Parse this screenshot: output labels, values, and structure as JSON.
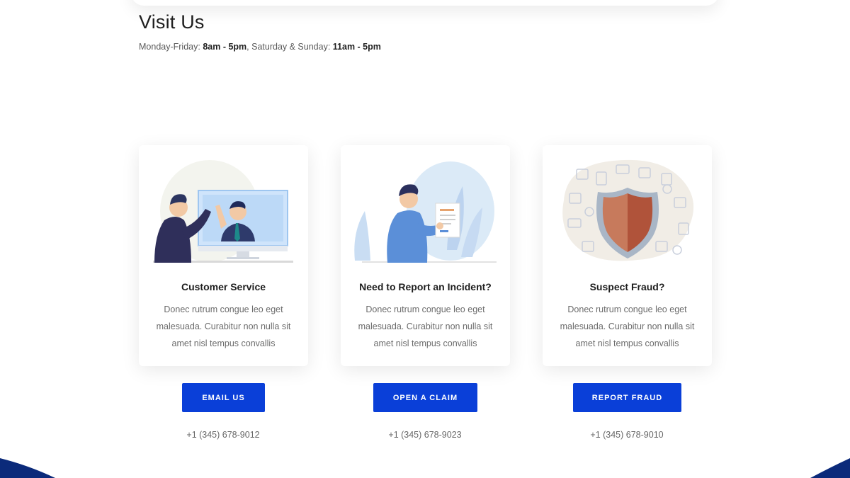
{
  "header": {
    "title": "Visit Us",
    "hours": {
      "weekday_label": "Monday-Friday:",
      "weekday_hours": "8am - 5pm",
      "weekend_label": ", Saturday & Sunday:",
      "weekend_hours": "11am - 5pm"
    }
  },
  "cards": [
    {
      "title": "Customer Service",
      "body": "Donec rutrum congue leo eget malesuada. Curabitur non nulla sit amet nisl tempus convallis",
      "button": "EMAIL US",
      "phone": "+1 (345) 678-9012",
      "icon": "customer-service-illustration"
    },
    {
      "title": "Need to Report an Incident?",
      "body": "Donec rutrum congue leo eget malesuada. Curabitur non nulla sit amet nisl tempus convallis",
      "button": "OPEN A CLAIM",
      "phone": "+1 (345) 678-9023",
      "icon": "report-incident-illustration"
    },
    {
      "title": "Suspect Fraud?",
      "body": "Donec rutrum congue leo eget malesuada. Curabitur non nulla sit amet nisl tempus convallis",
      "button": "REPORT FRAUD",
      "phone": "+1 (345) 678-9010",
      "icon": "fraud-shield-illustration"
    }
  ],
  "colors": {
    "accent": "#0a3fd8",
    "footer_navy": "#0b2a7a"
  }
}
